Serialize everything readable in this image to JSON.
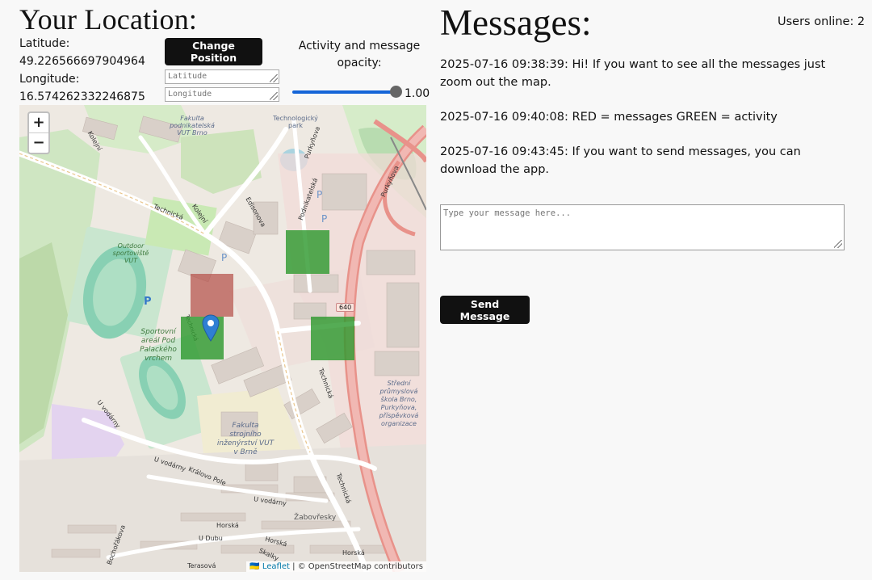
{
  "location": {
    "title": "Your Location:",
    "latitude_label": "Latitude:",
    "latitude_value": "49.226566697904964",
    "longitude_label": "Longitude:",
    "longitude_value": "16.574262332246875",
    "change_button": "Change Position",
    "lat_placeholder": "Latitude",
    "lon_placeholder": "Longitude"
  },
  "opacity": {
    "label": "Activity and message opacity:",
    "value": "1.00",
    "fraction": 1.0
  },
  "map": {
    "zoom_in": "+",
    "zoom_out": "−",
    "attribution_flag": "🇺🇦",
    "attribution_leaflet": "Leaflet",
    "attribution_rest": " | © OpenStreetMap contributors",
    "labels": {
      "fakulta_podnikatelska": "Fakulta podnikatelská VUT Brno",
      "technologicky_park": "Technologický park",
      "kolejni": "Kolejní",
      "technicka": "Technická",
      "edisonova": "Edisonova",
      "podnikatelska": "Podnikatelská",
      "purkynova": "Purkyňova",
      "outdoor": "Outdoor sportoviště VUT",
      "sportovni": "Sportovní areál Pod Palackého vrchem",
      "fakulta_strojni": "Fakulta strojního inženýrství VUT v Brně",
      "stredni": "Střední průmyslová škola Brno, Purkyňova, příspěvková organizace",
      "u_vodarny": "U vodárny",
      "kralovo_pole": "Královo Pole",
      "zabovresky": "Žabovřesky",
      "horska": "Horská",
      "u_dubu": "U Dubu",
      "skalky": "Skalky",
      "bochorakova": "Bochořákova",
      "terasova": "Terasová",
      "road_640": "640",
      "parking": "P"
    },
    "overlay_colors": {
      "message": "#b5514a",
      "activity": "#2f9a2f"
    }
  },
  "messages": {
    "title": "Messages:",
    "users_online": "Users online: 2",
    "items": [
      {
        "text": "2025-07-16 09:38:39: Hi! If you want to see all the messages just zoom out the map."
      },
      {
        "text": "2025-07-16 09:40:08: RED = messages GREEN = activity"
      },
      {
        "text": "2025-07-16 09:43:45: If you want to send messages, you can download the app."
      }
    ],
    "input_placeholder": "Type your message here...",
    "send_button": "Send Message"
  }
}
